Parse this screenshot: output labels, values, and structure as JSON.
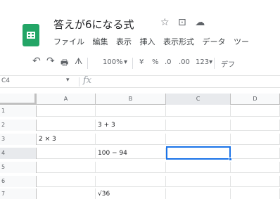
{
  "title": "答えが6になる式",
  "title_icons": [
    "☆",
    "⊡",
    "☁"
  ],
  "menu": [
    "ファイル",
    "編集",
    "表示",
    "挿入",
    "表示形式",
    "データ",
    "ツー"
  ],
  "toolbar": {
    "undo": "↶",
    "redo": "↷",
    "print": "🖶",
    "paint_format": "ᗑ",
    "zoom": "100%",
    "zoom_caret": "▾",
    "currency": "¥",
    "percent": "%",
    "decimal_decrease": ".0",
    "decimal_increase": ".00",
    "more_formats": "123▾",
    "font": "デフ"
  },
  "formula_bar": {
    "name_box": "C4",
    "name_caret": "▾",
    "fx": "fx",
    "value": ""
  },
  "grid": {
    "columns": [
      "A",
      "B",
      "C",
      "D"
    ],
    "rows": [
      {
        "num": "1",
        "cells": [
          "",
          "",
          "",
          ""
        ]
      },
      {
        "num": "2",
        "cells": [
          "",
          "3 + 3",
          "",
          ""
        ]
      },
      {
        "num": "3",
        "cells": [
          "2 × 3",
          "",
          "",
          ""
        ]
      },
      {
        "num": "4",
        "cells": [
          "",
          "100 − 94",
          "",
          ""
        ]
      },
      {
        "num": "5",
        "cells": [
          "",
          "",
          "",
          ""
        ]
      },
      {
        "num": "6",
        "cells": [
          "",
          "",
          "",
          ""
        ]
      },
      {
        "num": "7",
        "cells": [
          "",
          "√36",
          "",
          ""
        ]
      }
    ],
    "selected_cell": "C4"
  },
  "colors": {
    "logo_green": "#23a566",
    "selection_blue": "#1a73e8",
    "header_bg": "#f8f9fa"
  }
}
